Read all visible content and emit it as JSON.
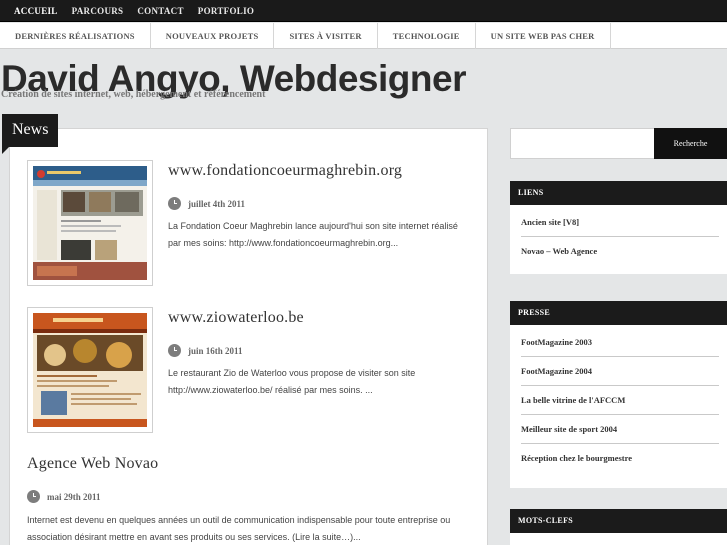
{
  "top_nav": [
    "ACCUEIL",
    "PARCOURS",
    "CONTACT",
    "PORTFOLIO"
  ],
  "category_nav": [
    "DERNIÈRES RÉALISATIONS",
    "NOUVEAUX PROJETS",
    "SITES À VISITER",
    "TECHNOLOGIE",
    "UN SITE WEB PAS CHER"
  ],
  "site": {
    "title": "David Angyo, Webdesigner",
    "description": "Création de sites internet, web, hébergement et référencement"
  },
  "section_label": "News",
  "posts": [
    {
      "title": "www.fondationcoeurmaghrebin.org",
      "date": "juillet 4th 2011",
      "excerpt": "La Fondation Coeur Maghrebin lance aujourd'hui son site internet réalisé par mes soins: http://www.fondationcoeurmaghrebin.org...",
      "thumb_label": "fondation coeur maghrebin"
    },
    {
      "title": "www.ziowaterloo.be",
      "date": "juin 16th 2011",
      "excerpt": "Le restaurant Zio de Waterloo vous propose de visiter son site http://www.ziowaterloo.be/ réalisé par mes soins. ...",
      "thumb_label": "Zio Waterloo"
    },
    {
      "title": "Agence Web Novao",
      "date": "mai 29th 2011",
      "excerpt": "Internet est devenu en quelques années un outil de communication indispensable pour toute entreprise ou association désirant mettre en avant ses produits ou ses services. (Lire la suite…)..."
    }
  ],
  "search": {
    "button_label": "Recherche",
    "value": ""
  },
  "sidebar": {
    "liens": {
      "title": "LIENS",
      "items": [
        "Ancien site [V8]",
        "Novao – Web Agence"
      ]
    },
    "presse": {
      "title": "PRESSE",
      "items": [
        "FootMagazine 2003",
        "FootMagazine 2004",
        "La belle vitrine de l'AFCCM",
        "Meilleur site de sport 2004",
        "Réception chez le bourgmestre"
      ]
    },
    "mots_clefs": {
      "title": "MOTS-CLEFS"
    }
  },
  "colors": {
    "background": "#e4e6e7",
    "dark_bar": "#1b1b1b",
    "panel": "#ffffff"
  },
  "icons": {
    "date": "clock-icon"
  }
}
